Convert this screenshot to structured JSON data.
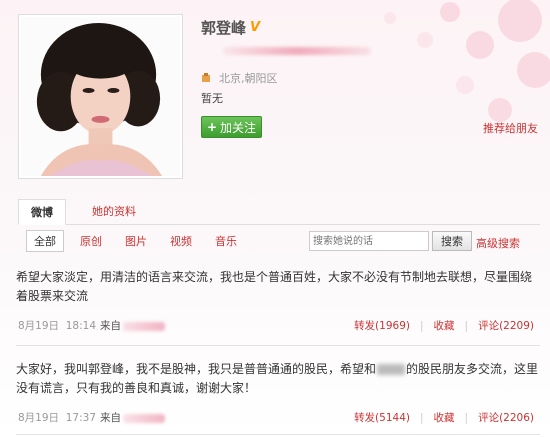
{
  "profile": {
    "name": "郭登峰",
    "verified_badge": "V",
    "location": "北京,朝阳区",
    "intro": "暂无",
    "follow_label": "加关注",
    "recommend_label": "推荐给朋友"
  },
  "tabs": [
    {
      "label": "微博",
      "active": true
    },
    {
      "label": "她的资料",
      "active": false
    }
  ],
  "filters": [
    {
      "label": "全部",
      "active": true
    },
    {
      "label": "原创"
    },
    {
      "label": "图片"
    },
    {
      "label": "视频"
    },
    {
      "label": "音乐"
    }
  ],
  "search": {
    "placeholder": "搜索她说的话",
    "button_label": "搜索",
    "advanced_label": "高级搜索"
  },
  "posts": [
    {
      "text": "希望大家淡定，用清洁的语言来交流，我也是个普通百姓，大家不必没有节制地去联想，尽量围绕着股票来交流",
      "date": "8月19日",
      "time": "18:14",
      "from_label": "来自",
      "repost_label": "转发(1969)",
      "fav_label": "收藏",
      "comment_label": "评论(2209)"
    },
    {
      "text_before": "大家好，我叫郭登峰，我不是股神，我只是普普通通的股民，希望和",
      "text_after": "的股民朋友多交流，这里没有谎言，只有我的善良和真诚，谢谢大家！",
      "date": "8月19日",
      "time": "17:37",
      "from_label": "来自",
      "repost_label": "转发(5144)",
      "fav_label": "收藏",
      "comment_label": "评论(2206)"
    }
  ],
  "colors": {
    "accent_red": "#cc3333",
    "follow_green": "#3c9e2e",
    "badge_orange": "#ff9900"
  }
}
